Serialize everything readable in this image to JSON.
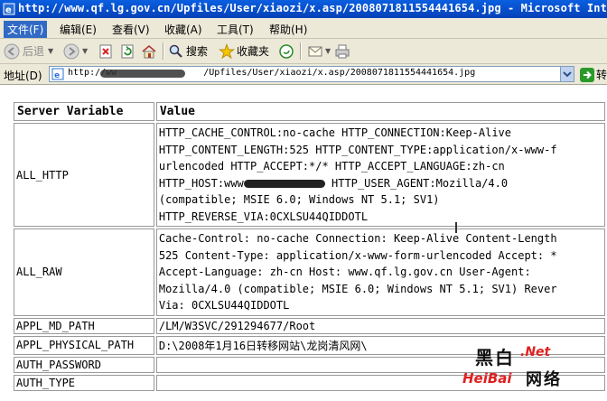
{
  "window": {
    "title": "http://www.qf.lg.gov.cn/Upfiles/User/xiaozi/x.asp/2008071811554441654.jpg - Microsoft Intern"
  },
  "menu": [
    "文件(F)",
    "编辑(E)",
    "查看(V)",
    "收藏(A)",
    "工具(T)",
    "帮助(H)"
  ],
  "toolbar": {
    "back_label": "后退",
    "search_label": "搜索",
    "favorites_label": "收藏夹"
  },
  "address": {
    "label": "地址(D)",
    "url_prefix": "http://ww",
    "url_suffix": "/Upfiles/User/xiaozi/x.asp/2008071811554441654.jpg",
    "go_label": "转到"
  },
  "table": {
    "headers": [
      "Server Variable",
      "Value"
    ],
    "rows": [
      {
        "name": "ALL_HTTP",
        "lines": [
          "HTTP_CACHE_CONTROL:no-cache HTTP_CONNECTION:Keep-Alive",
          "HTTP_CONTENT_LENGTH:525 HTTP_CONTENT_TYPE:application/x-www-f",
          "urlencoded HTTP_ACCEPT:*/* HTTP_ACCEPT_LANGUAGE:zh-cn",
          "HTTP_HOST:www",
          "(compatible; MSIE 6.0; Windows NT 5.1; SV1)",
          "HTTP_REVERSE_VIA:0CXLSU44QIDDOTL"
        ],
        "host_tail": " HTTP_USER_AGENT:Mozilla/4.0"
      },
      {
        "name": "ALL_RAW",
        "lines": [
          "Cache-Control: no-cache Connection: Keep-Alive Content-Length",
          "525 Content-Type: application/x-www-form-urlencoded Accept: *",
          "Accept-Language: zh-cn Host: www.qf.lg.gov.cn User-Agent:",
          "Mozilla/4.0 (compatible; MSIE 6.0; Windows NT 5.1; SV1) Rever",
          "Via: 0CXLSU44QIDDOTL"
        ]
      },
      {
        "name": "APPL_MD_PATH",
        "lines": [
          "/LM/W3SVC/291294677/Root"
        ]
      },
      {
        "name": "APPL_PHYSICAL_PATH",
        "lines": [
          "D:\\2008年1月16日转移网站\\龙岗清风网\\"
        ]
      },
      {
        "name": "AUTH_PASSWORD",
        "lines": [
          ""
        ]
      },
      {
        "name": "AUTH_TYPE",
        "lines": [
          ""
        ]
      }
    ]
  },
  "watermark": {
    "cn_top": "黑白",
    "net": ".Net",
    "heibai": "HeiBai",
    "cn_bottom": "网络"
  }
}
